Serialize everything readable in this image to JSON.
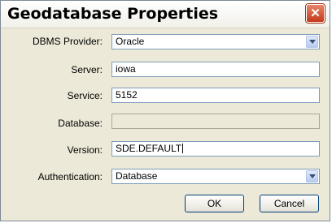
{
  "window": {
    "title": "Geodatabase Properties",
    "close_glyph": "✕"
  },
  "form": {
    "dbms_provider": {
      "label": "DBMS Provider:",
      "value": "Oracle"
    },
    "server": {
      "label": "Server:",
      "value": "iowa"
    },
    "service": {
      "label": "Service:",
      "value": "5152"
    },
    "database": {
      "label": "Database:",
      "value": ""
    },
    "version": {
      "label": "Version:",
      "value": "SDE.DEFAULT"
    },
    "authentication": {
      "label": "Authentication:",
      "value": "Database"
    }
  },
  "buttons": {
    "ok": "OK",
    "cancel": "Cancel"
  },
  "icons": {
    "close": "close-icon",
    "dropdown": "chevron-down-icon"
  },
  "colors": {
    "close_button": "#c43a19",
    "field_border": "#7f9db9",
    "dialog_bg": "#ece9d8"
  }
}
